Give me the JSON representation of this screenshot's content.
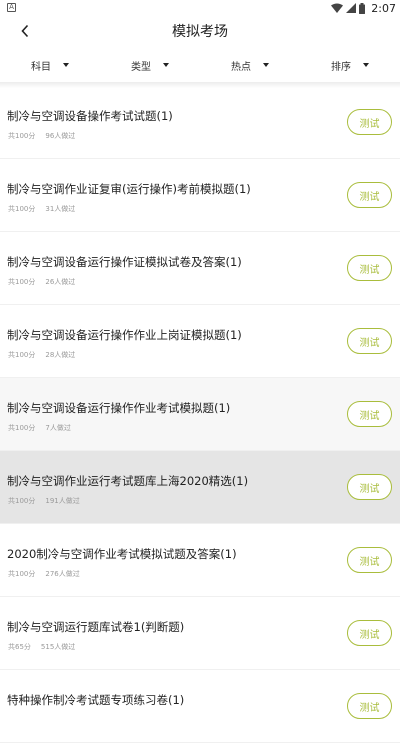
{
  "status": {
    "left_icon": "A",
    "time": "2:07"
  },
  "header": {
    "title": "模拟考场"
  },
  "filters": [
    "科目",
    "类型",
    "热点",
    "排序"
  ],
  "test_label": "测试",
  "items": [
    {
      "title": "制冷与空调设备操作考试试题(1)",
      "total": "共100分",
      "count": "96人做过"
    },
    {
      "title": "制冷与空调作业证复审(运行操作)考前模拟题(1)",
      "total": "共100分",
      "count": "31人做过"
    },
    {
      "title": "制冷与空调设备运行操作证模拟试卷及答案(1)",
      "total": "共100分",
      "count": "26人做过"
    },
    {
      "title": "制冷与空调设备运行操作作业上岗证模拟题(1)",
      "total": "共100分",
      "count": "28人做过"
    },
    {
      "title": "制冷与空调设备运行操作作业考试模拟题(1)",
      "total": "共100分",
      "count": "7人做过"
    },
    {
      "title": "制冷与空调作业运行考试题库上海2020精选(1)",
      "total": "共100分",
      "count": "191人做过"
    },
    {
      "title": "2020制冷与空调作业考试模拟试题及答案(1)",
      "total": "共100分",
      "count": "276人做过"
    },
    {
      "title": "制冷与空调运行题库试卷1(判断题)",
      "total": "共65分",
      "count": "515人做过"
    },
    {
      "title": "特种操作制冷考试题专项练习卷(1)",
      "total": "",
      "count": ""
    }
  ]
}
